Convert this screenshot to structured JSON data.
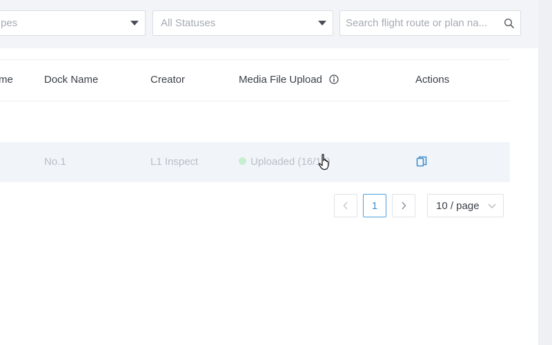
{
  "filters": {
    "types_label": "pes",
    "status_label": "All Statuses",
    "search_placeholder": "Search flight route or plan na..."
  },
  "table": {
    "columns": [
      "me",
      "Dock Name",
      "Creator",
      "Media File Upload",
      "Actions"
    ],
    "rows": [
      {
        "name": "",
        "dock": "No.1",
        "creator": "L1 Inspect",
        "upload_status": "Uploaded (16/16)"
      }
    ]
  },
  "pagination": {
    "prev": "<",
    "current": "1",
    "next": ">",
    "page_size": "10 / page"
  },
  "colors": {
    "accent": "#3c8fcf",
    "uploaded_dot": "#c6efd0",
    "row_hover": "#f1f5fa"
  }
}
